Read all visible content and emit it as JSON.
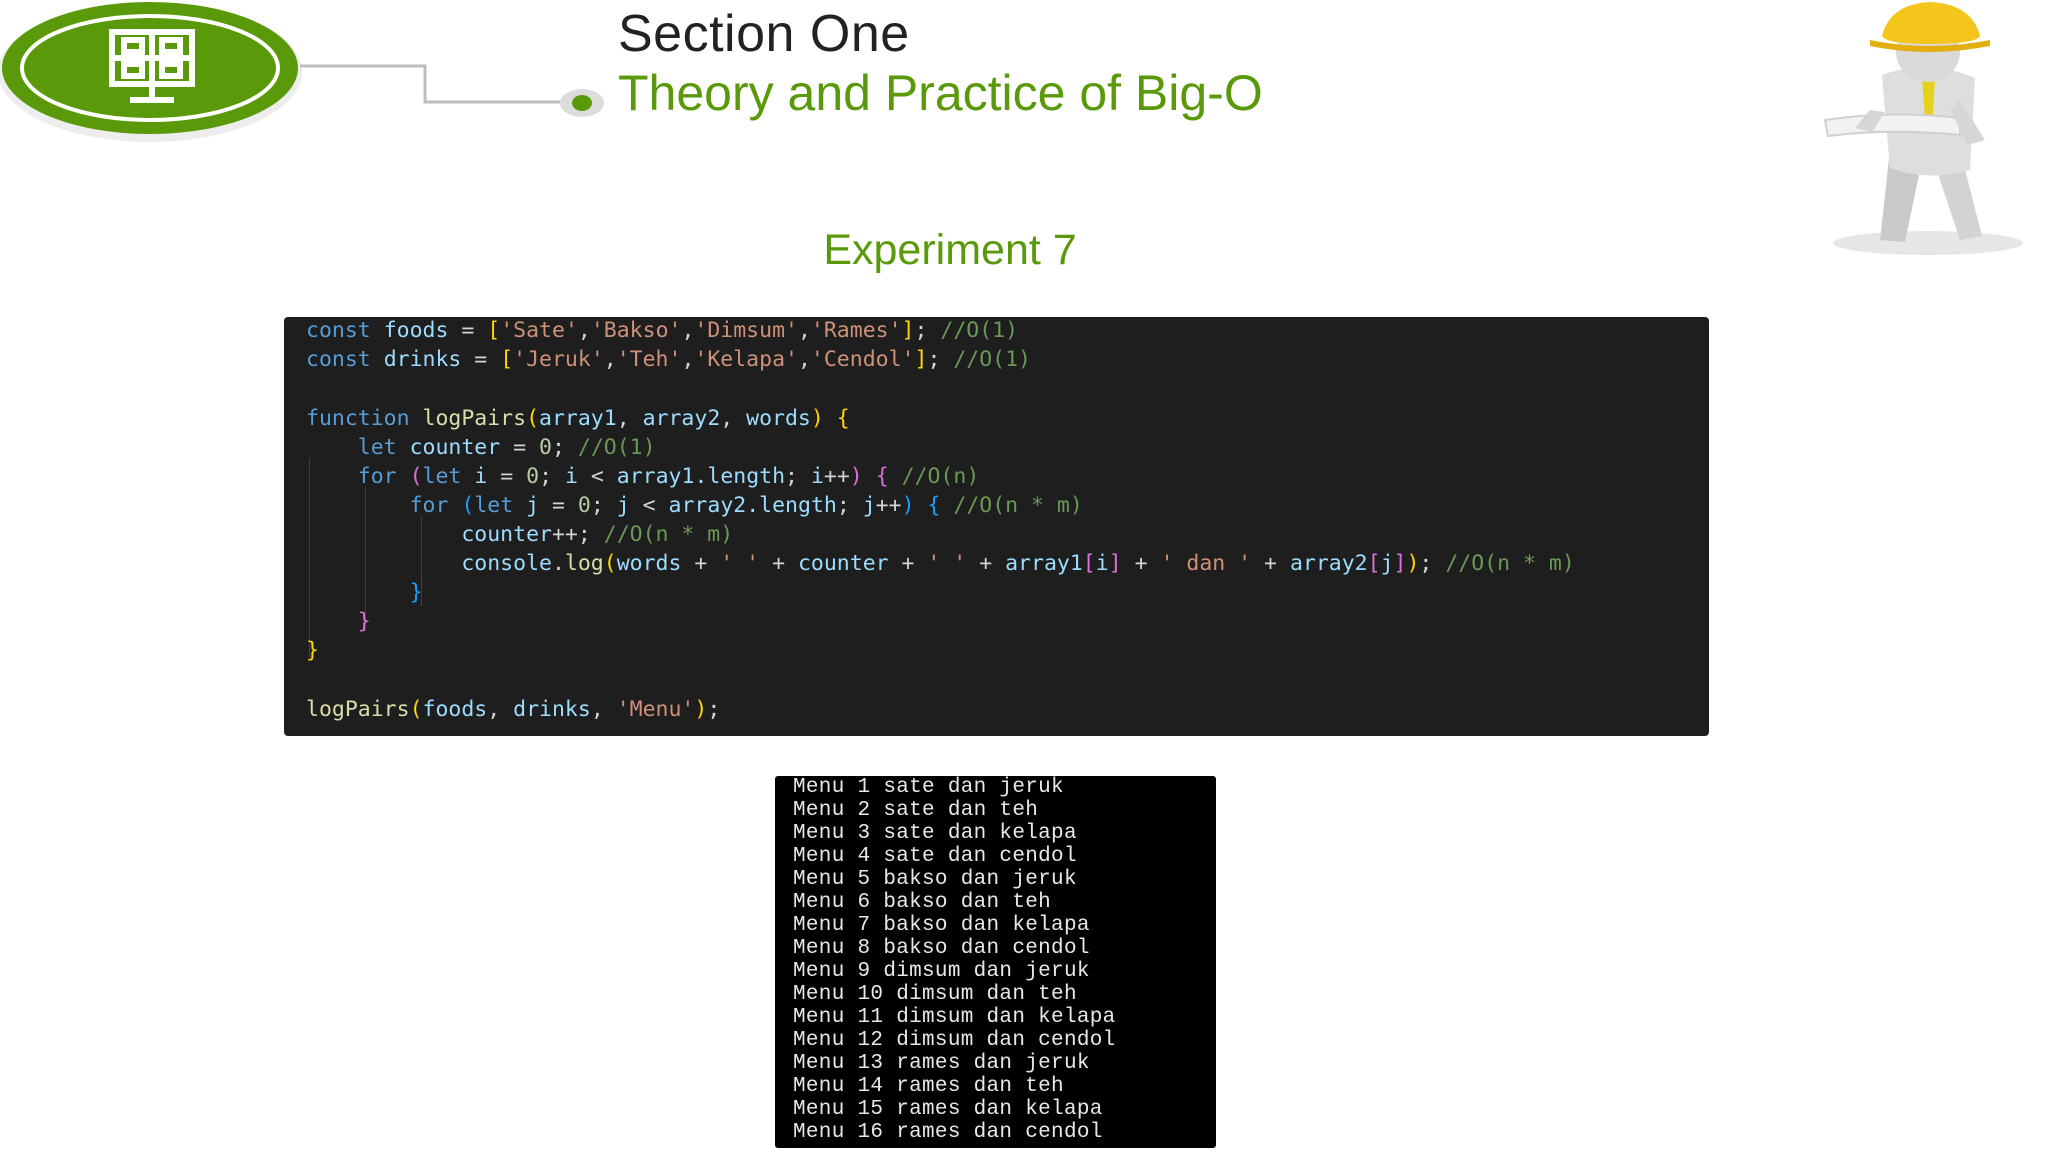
{
  "header": {
    "section_title": "Section One",
    "section_subtitle": "Theory and Practice of Big-O"
  },
  "slide": {
    "heading": "Experiment 7"
  },
  "colors": {
    "brand_green": "#5a9a0a",
    "code_bg": "#1e1e1e",
    "terminal_bg": "#000000"
  },
  "icons": {
    "logo": "university-emblem-icon",
    "figure": "engineer-with-hardhat-icon"
  },
  "code": {
    "l1": {
      "k": "const",
      "v": "foods",
      "eq": " = ",
      "b": "[",
      "s1": "'Sate'",
      "s2": "'Bakso'",
      "s3": "'Dimsum'",
      "s4": "'Rames'",
      "end": "];",
      "c": "//O(1)"
    },
    "l2": {
      "k": "const",
      "v": "drinks",
      "eq": " = ",
      "b": "[",
      "s1": "'Jeruk'",
      "s2": "'Teh'",
      "s3": "'Kelapa'",
      "s4": "'Cendol'",
      "end": "];",
      "c": "//O(1)"
    },
    "l4": {
      "k": "function",
      "f": "logPairs",
      "p1": "array1",
      "p2": "array2",
      "p3": "words",
      "brace": "{"
    },
    "l5": {
      "k": "let",
      "v": "counter",
      "eq": " = ",
      "n": "0",
      "semi": ";",
      "c": "//O(1)"
    },
    "l6": {
      "k": "for",
      "k2": "let",
      "v": "i",
      "eq": " = ",
      "n": "0",
      "mid1": "; ",
      "v2": "i",
      "lt": " < ",
      "v3": "array1",
      "prop": ".length",
      "mid2": "; ",
      "v4": "i",
      "inc": "++",
      "brace": "{",
      "c": "//O(n)"
    },
    "l7": {
      "k": "for",
      "k2": "let",
      "v": "j",
      "eq": " = ",
      "n": "0",
      "mid1": "; ",
      "v2": "j",
      "lt": " < ",
      "v3": "array2",
      "prop": ".length",
      "mid2": "; ",
      "v4": "j",
      "inc": "++",
      "brace": "{",
      "c": "//O(n * m)"
    },
    "l8": {
      "v": "counter",
      "op": "++;",
      "c": "//O(n * m)"
    },
    "l9": {
      "obj": "console",
      "f": "log",
      "v1": "words",
      "plus": " + ",
      "s1": "' '",
      "v2": "counter",
      "s2": "' '",
      "v3": "array1",
      "idx1": "i",
      "s3": "' dan '",
      "v4": "array2",
      "idx2": "j",
      "end": ";",
      "c": "//O(n * m)"
    },
    "l10": {
      "brace": "}"
    },
    "l11": {
      "brace": "}"
    },
    "l12": {
      "brace": "}"
    },
    "l14": {
      "f": "logPairs",
      "a1": "foods",
      "a2": "drinks",
      "s": "'Menu'",
      "end": ";"
    }
  },
  "terminal": {
    "lines": [
      "Menu 1 sate dan jeruk",
      "Menu 2 sate dan teh",
      "Menu 3 sate dan kelapa",
      "Menu 4 sate dan cendol",
      "Menu 5 bakso dan jeruk",
      "Menu 6 bakso dan teh",
      "Menu 7 bakso dan kelapa",
      "Menu 8 bakso dan cendol",
      "Menu 9 dimsum dan jeruk",
      "Menu 10 dimsum dan teh",
      "Menu 11 dimsum dan kelapa",
      "Menu 12 dimsum dan cendol",
      "Menu 13 rames dan jeruk",
      "Menu 14 rames dan teh",
      "Menu 15 rames dan kelapa",
      "Menu 16 rames dan cendol"
    ]
  }
}
